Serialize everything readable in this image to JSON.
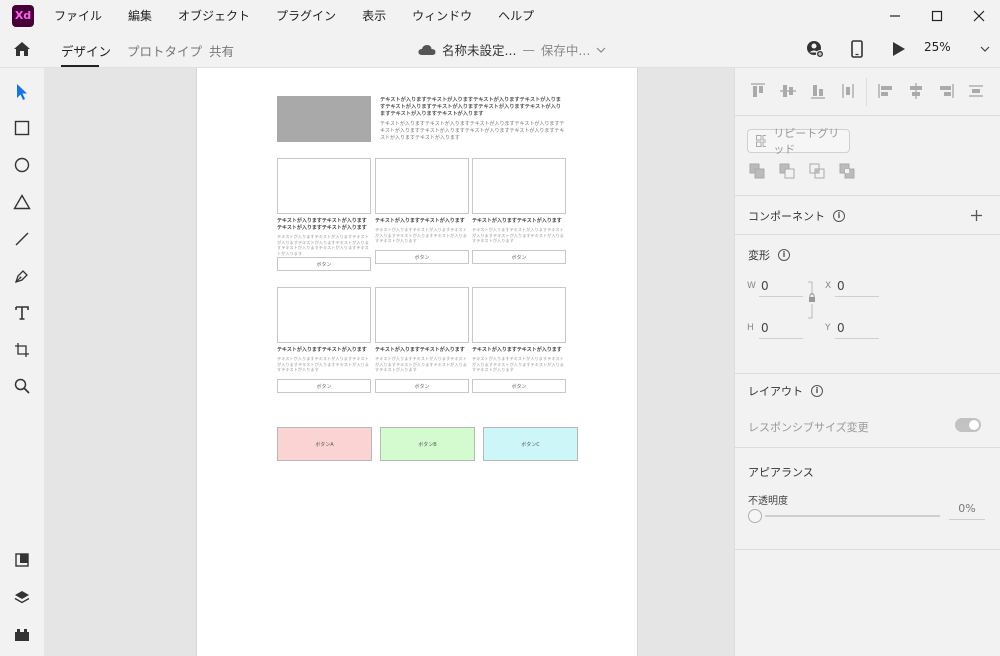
{
  "app": {
    "logo": "Xd",
    "menu": [
      "ファイル",
      "編集",
      "オブジェクト",
      "プラグイン",
      "表示",
      "ウィンドウ",
      "ヘルプ"
    ]
  },
  "toolbar": {
    "tabs": [
      "デザイン",
      "プロトタイプ",
      "共有"
    ],
    "doc_title": "名称未設定...",
    "doc_separator": "—",
    "doc_status": "保存中...",
    "zoom": "25%"
  },
  "artboard": {
    "hero_title": "テキストが入りますテキストが入りますテキストが入りますテキストが入りますテキストが入りますテキストが入りますテキストが入りますテキストが入りますテキストが入りますテキストが入ります",
    "hero_body": "テキストが入りますテキストが入りますテキストが入りますテキストが入りますテキストが入りますテキストが入りますテキストが入りますテキストが入りますテキストが入りますテキストが入ります",
    "cards_row1": [
      {
        "title": "テキストが入りますテキストが入りますテキストが入りますテキストが入ります",
        "text": "テキストが入りますテキストが入りますテキストが入りますテキストが入りますテキストが入りますテキストが入りますテキストが入りますテキストが入ります",
        "button": "ボタン"
      },
      {
        "title": "テキストが入りますテキストが入ります",
        "text": "テキストが入りますテキストが入りますテキストが入りますテキストが入りますテキストが入りますテキストが入ります",
        "button": "ボタン"
      },
      {
        "title": "テキストが入りますテキストが入ります",
        "text": "テキストが入りますテキストが入りますテキストが入りますテキストが入りますテキストが入りますテキストが入ります",
        "button": "ボタン"
      }
    ],
    "cards_row2": [
      {
        "title": "テキストが入りますテキストが入ります",
        "text": "テキストが入りますテキストが入りますテキストが入りますテキストが入りますテキストが入りますテキストが入ります",
        "button": "ボタン"
      },
      {
        "title": "テキストが入りますテキストが入ります",
        "text": "テキストが入りますテキストが入りますテキストが入りますテキストが入りますテキストが入りますテキストが入ります",
        "button": "ボタン"
      },
      {
        "title": "テキストが入りますテキストが入ります",
        "text": "テキストが入りますテキストが入りますテキストが入りますテキストが入りますテキストが入りますテキストが入ります",
        "button": "ボタン"
      }
    ],
    "color_buttons": [
      {
        "label": "ボタンA",
        "color": "#fbd3d3"
      },
      {
        "label": "ボタンB",
        "color": "#d4fbd0"
      },
      {
        "label": "ボタンC",
        "color": "#cdf6f8"
      }
    ]
  },
  "properties": {
    "repeat_grid": "リピートグリッド",
    "component": "コンポーネント",
    "transform": "変形",
    "w_label": "W",
    "w_value": "0",
    "x_label": "X",
    "x_value": "0",
    "h_label": "H",
    "h_value": "0",
    "y_label": "Y",
    "y_value": "0",
    "layout": "レイアウト",
    "responsive": "レスポンシブサイズ変更",
    "appearance": "アピアランス",
    "opacity_label": "不透明度",
    "opacity_value": "0%"
  },
  "colors": {
    "accent": "#1473e6",
    "logo_bg": "#470137",
    "logo_fg": "#ff61f6"
  }
}
